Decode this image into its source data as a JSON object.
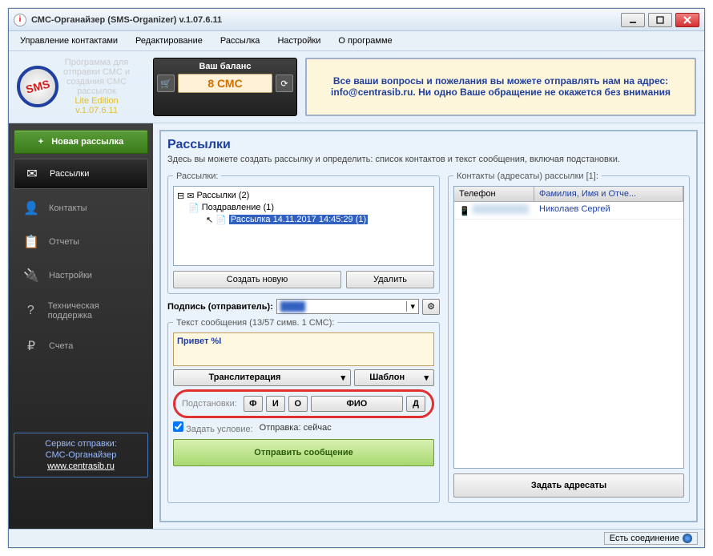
{
  "window": {
    "title": "СМС-Органайзер (SMS-Organizer) v.1.07.6.11"
  },
  "menu": {
    "contacts": "Управление контактами",
    "edit": "Редактирование",
    "mailing": "Рассылка",
    "settings": "Настройки",
    "about": "О программе"
  },
  "logo": {
    "text": "SMS",
    "desc1": "Программа для",
    "desc2": "отправки СМС и",
    "desc3": "создания СМС",
    "desc4": "рассылок",
    "edition": "Lite Edition",
    "version": "v.1.07.6.11"
  },
  "balance": {
    "title": "Ваш баланс",
    "value": "8 СМС"
  },
  "banner": {
    "text": "Все ваши вопросы и пожелания вы можете отправлять нам на адрес: info@centrasib.ru. Ни одно Ваше обращение не окажется без внимания"
  },
  "sidebar": {
    "new": "Новая рассылка",
    "items": [
      {
        "label": "Рассылки",
        "icon": "✉"
      },
      {
        "label": "Контакты",
        "icon": "👤"
      },
      {
        "label": "Отчеты",
        "icon": "📋"
      },
      {
        "label": "Настройки",
        "icon": "🔌"
      },
      {
        "label": "Техническая поддержка",
        "icon": "?"
      },
      {
        "label": "Счета",
        "icon": "₽"
      }
    ],
    "footer": {
      "line1": "Сервис отправки:",
      "line2": "СМС-Органайзер",
      "link": "www.centrasib.ru"
    }
  },
  "page": {
    "title": "Рассылки",
    "subtitle": "Здесь вы можете создать рассылку и определить: список контактов и текст сообщения, включая подстановки."
  },
  "mailings": {
    "legend": "Рассылки:",
    "root": "Рассылки (2)",
    "item1": "Поздравление (1)",
    "item2": "Рассылка 14.11.2017 14:45:29 (1)",
    "create": "Создать новую",
    "delete": "Удалить"
  },
  "signature": {
    "label": "Подпись (отправитель):"
  },
  "message": {
    "legend": "Текст сообщения (13/57 симв. 1 СМС):",
    "text": "Привет %I",
    "translit": "Транслитерация",
    "template": "Шаблон",
    "subst_label": "Подстановки:",
    "f": "Ф",
    "i": "И",
    "o": "О",
    "fio": "ФИО",
    "d": "Д",
    "condition": "Задать условие:",
    "schedule": "Отправка: сейчас",
    "send": "Отправить сообщение"
  },
  "contacts": {
    "legend": "Контакты (адресаты) рассылки [1]:",
    "col_phone": "Телефон",
    "col_name": "Фамилия, Имя и Отче...",
    "row1_name": "Николаев Сергей",
    "set_btn": "Задать адресаты"
  },
  "status": {
    "connection": "Есть соединение"
  }
}
